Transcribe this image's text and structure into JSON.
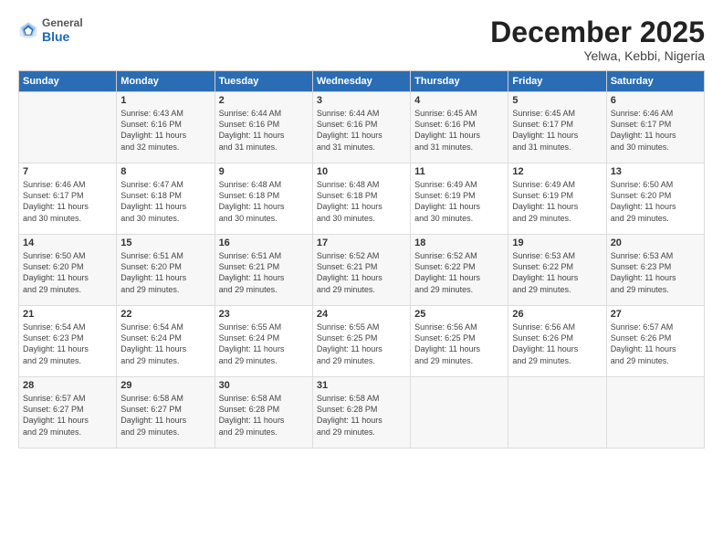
{
  "logo": {
    "general": "General",
    "blue": "Blue"
  },
  "title": "December 2025",
  "subtitle": "Yelwa, Kebbi, Nigeria",
  "headers": [
    "Sunday",
    "Monday",
    "Tuesday",
    "Wednesday",
    "Thursday",
    "Friday",
    "Saturday"
  ],
  "weeks": [
    [
      {
        "day": "",
        "info": ""
      },
      {
        "day": "1",
        "info": "Sunrise: 6:43 AM\nSunset: 6:16 PM\nDaylight: 11 hours\nand 32 minutes."
      },
      {
        "day": "2",
        "info": "Sunrise: 6:44 AM\nSunset: 6:16 PM\nDaylight: 11 hours\nand 31 minutes."
      },
      {
        "day": "3",
        "info": "Sunrise: 6:44 AM\nSunset: 6:16 PM\nDaylight: 11 hours\nand 31 minutes."
      },
      {
        "day": "4",
        "info": "Sunrise: 6:45 AM\nSunset: 6:16 PM\nDaylight: 11 hours\nand 31 minutes."
      },
      {
        "day": "5",
        "info": "Sunrise: 6:45 AM\nSunset: 6:17 PM\nDaylight: 11 hours\nand 31 minutes."
      },
      {
        "day": "6",
        "info": "Sunrise: 6:46 AM\nSunset: 6:17 PM\nDaylight: 11 hours\nand 30 minutes."
      }
    ],
    [
      {
        "day": "7",
        "info": "Sunrise: 6:46 AM\nSunset: 6:17 PM\nDaylight: 11 hours\nand 30 minutes."
      },
      {
        "day": "8",
        "info": "Sunrise: 6:47 AM\nSunset: 6:18 PM\nDaylight: 11 hours\nand 30 minutes."
      },
      {
        "day": "9",
        "info": "Sunrise: 6:48 AM\nSunset: 6:18 PM\nDaylight: 11 hours\nand 30 minutes."
      },
      {
        "day": "10",
        "info": "Sunrise: 6:48 AM\nSunset: 6:18 PM\nDaylight: 11 hours\nand 30 minutes."
      },
      {
        "day": "11",
        "info": "Sunrise: 6:49 AM\nSunset: 6:19 PM\nDaylight: 11 hours\nand 30 minutes."
      },
      {
        "day": "12",
        "info": "Sunrise: 6:49 AM\nSunset: 6:19 PM\nDaylight: 11 hours\nand 29 minutes."
      },
      {
        "day": "13",
        "info": "Sunrise: 6:50 AM\nSunset: 6:20 PM\nDaylight: 11 hours\nand 29 minutes."
      }
    ],
    [
      {
        "day": "14",
        "info": "Sunrise: 6:50 AM\nSunset: 6:20 PM\nDaylight: 11 hours\nand 29 minutes."
      },
      {
        "day": "15",
        "info": "Sunrise: 6:51 AM\nSunset: 6:20 PM\nDaylight: 11 hours\nand 29 minutes."
      },
      {
        "day": "16",
        "info": "Sunrise: 6:51 AM\nSunset: 6:21 PM\nDaylight: 11 hours\nand 29 minutes."
      },
      {
        "day": "17",
        "info": "Sunrise: 6:52 AM\nSunset: 6:21 PM\nDaylight: 11 hours\nand 29 minutes."
      },
      {
        "day": "18",
        "info": "Sunrise: 6:52 AM\nSunset: 6:22 PM\nDaylight: 11 hours\nand 29 minutes."
      },
      {
        "day": "19",
        "info": "Sunrise: 6:53 AM\nSunset: 6:22 PM\nDaylight: 11 hours\nand 29 minutes."
      },
      {
        "day": "20",
        "info": "Sunrise: 6:53 AM\nSunset: 6:23 PM\nDaylight: 11 hours\nand 29 minutes."
      }
    ],
    [
      {
        "day": "21",
        "info": "Sunrise: 6:54 AM\nSunset: 6:23 PM\nDaylight: 11 hours\nand 29 minutes."
      },
      {
        "day": "22",
        "info": "Sunrise: 6:54 AM\nSunset: 6:24 PM\nDaylight: 11 hours\nand 29 minutes."
      },
      {
        "day": "23",
        "info": "Sunrise: 6:55 AM\nSunset: 6:24 PM\nDaylight: 11 hours\nand 29 minutes."
      },
      {
        "day": "24",
        "info": "Sunrise: 6:55 AM\nSunset: 6:25 PM\nDaylight: 11 hours\nand 29 minutes."
      },
      {
        "day": "25",
        "info": "Sunrise: 6:56 AM\nSunset: 6:25 PM\nDaylight: 11 hours\nand 29 minutes."
      },
      {
        "day": "26",
        "info": "Sunrise: 6:56 AM\nSunset: 6:26 PM\nDaylight: 11 hours\nand 29 minutes."
      },
      {
        "day": "27",
        "info": "Sunrise: 6:57 AM\nSunset: 6:26 PM\nDaylight: 11 hours\nand 29 minutes."
      }
    ],
    [
      {
        "day": "28",
        "info": "Sunrise: 6:57 AM\nSunset: 6:27 PM\nDaylight: 11 hours\nand 29 minutes."
      },
      {
        "day": "29",
        "info": "Sunrise: 6:58 AM\nSunset: 6:27 PM\nDaylight: 11 hours\nand 29 minutes."
      },
      {
        "day": "30",
        "info": "Sunrise: 6:58 AM\nSunset: 6:28 PM\nDaylight: 11 hours\nand 29 minutes."
      },
      {
        "day": "31",
        "info": "Sunrise: 6:58 AM\nSunset: 6:28 PM\nDaylight: 11 hours\nand 29 minutes."
      },
      {
        "day": "",
        "info": ""
      },
      {
        "day": "",
        "info": ""
      },
      {
        "day": "",
        "info": ""
      }
    ]
  ]
}
